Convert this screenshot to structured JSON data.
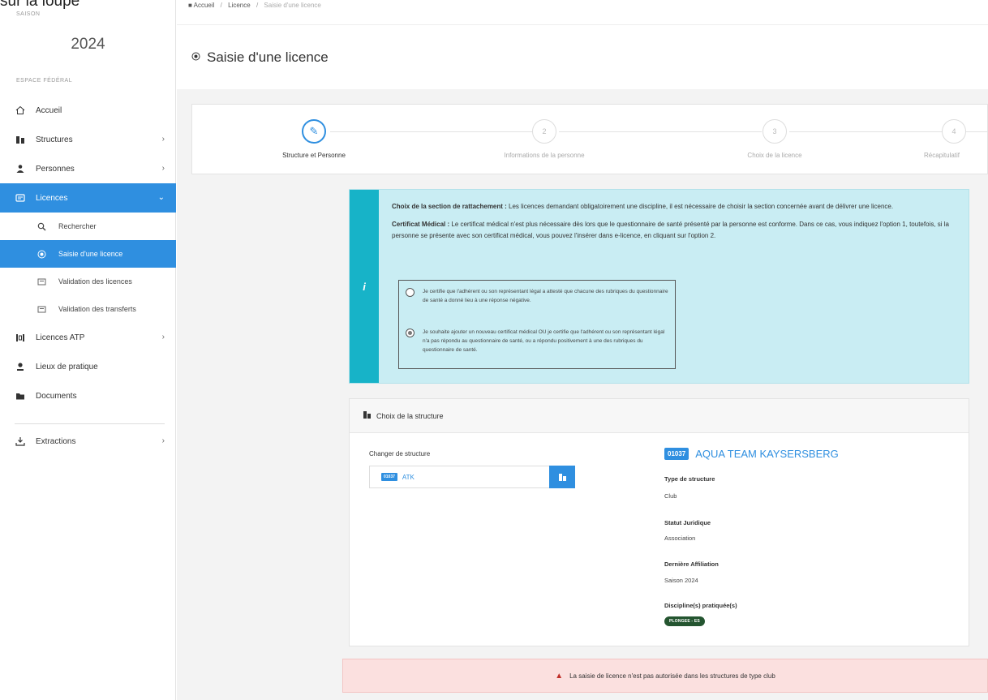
{
  "overlay": {
    "text": "sur la loupe"
  },
  "sidebar": {
    "season_label": "SAISON",
    "season_year": "2024",
    "espace_label": "ESPACE FÉDÉRAL",
    "items": [
      {
        "label": "Accueil",
        "icon": "home-icon"
      },
      {
        "label": "Structures",
        "icon": "building-icon",
        "has_children": true
      },
      {
        "label": "Personnes",
        "icon": "users-icon",
        "has_children": true
      },
      {
        "label": "Licences",
        "icon": "license-icon",
        "active": true,
        "expanded": true,
        "children": [
          {
            "label": "Rechercher",
            "icon": "search-icon"
          },
          {
            "label": "Saisie d'une licence",
            "icon": "edit-icon",
            "active": true
          },
          {
            "label": "Validation des licences",
            "icon": "license-check-icon"
          },
          {
            "label": "Validation des transferts",
            "icon": "transfer-icon"
          }
        ]
      },
      {
        "label": "Licences ATP",
        "icon": "atp-icon",
        "has_children": true
      },
      {
        "label": "Lieux de pratique",
        "icon": "location-icon"
      },
      {
        "label": "Documents",
        "icon": "folder-icon"
      },
      {
        "label": "Extractions",
        "icon": "download-icon",
        "has_children": true
      }
    ]
  },
  "breadcrumb": {
    "home": "Accueil",
    "section": "Licence",
    "current": "Saisie d'une licence"
  },
  "page": {
    "title": "Saisie d'une licence"
  },
  "stepper": {
    "steps": [
      {
        "num": "✎",
        "label": "Structure et Personne",
        "active": true
      },
      {
        "num": "2",
        "label": "Informations de la personne"
      },
      {
        "num": "3",
        "label": "Choix de la licence"
      },
      {
        "num": "4",
        "label": "Récapitulatif"
      }
    ]
  },
  "info": {
    "icon_letter": "i",
    "p1_bold": "Choix de la section de rattachement :",
    "p1_text": " Les licences demandant obligatoirement une discipline, il est nécessaire de choisir la section concernée avant de délivrer une licence.",
    "p2_bold": "Certificat Médical :",
    "p2_text": " Le certificat médical n'est plus nécessaire  dès lors que le questionnaire de santé présenté par la personne est conforme. Dans ce cas, vous indiquez l'option 1, toutefois, si la personne se présente avec son certificat médical, vous pouvez l'insérer dans e-licence, en cliquant sur l'option 2.",
    "option1": "Je certifie que l'adhérent ou son représentant légal a attesté que chacune des rubriques du questionnaire de santé a donné lieu à une réponse négative.",
    "option2": "Je souhaite ajouter un nouveau certificat médical OU je certifie que l'adhérent ou son représentant légal n'a pas répondu au questionnaire de santé, ou a répondu positivement à une des rubriques du questionnaire de santé."
  },
  "structure": {
    "panel_title": "Choix de la structure",
    "change_label": "Changer de structure",
    "input_code": "01037",
    "input_value": "ATK",
    "code": "01037",
    "name": "AQUA TEAM KAYSERSBERG",
    "type_label": "Type de structure",
    "type_value": "Club",
    "statut_label": "Statut Juridique",
    "statut_value": "Association",
    "affil_label": "Dernière Affiliation",
    "affil_value": "Saison 2024",
    "disc_label": "Discipline(s) pratiquée(s)",
    "disc_value": "PLONGEE - ES"
  },
  "alert": {
    "text": "La saisie de licence n'est pas autorisée dans les structures de type club"
  },
  "colors": {
    "primary": "#2f8fe0",
    "info_bg": "#c9edf3",
    "info_strip": "#17b3c8",
    "alert_bg": "#fbe0df",
    "pill": "#245530"
  }
}
